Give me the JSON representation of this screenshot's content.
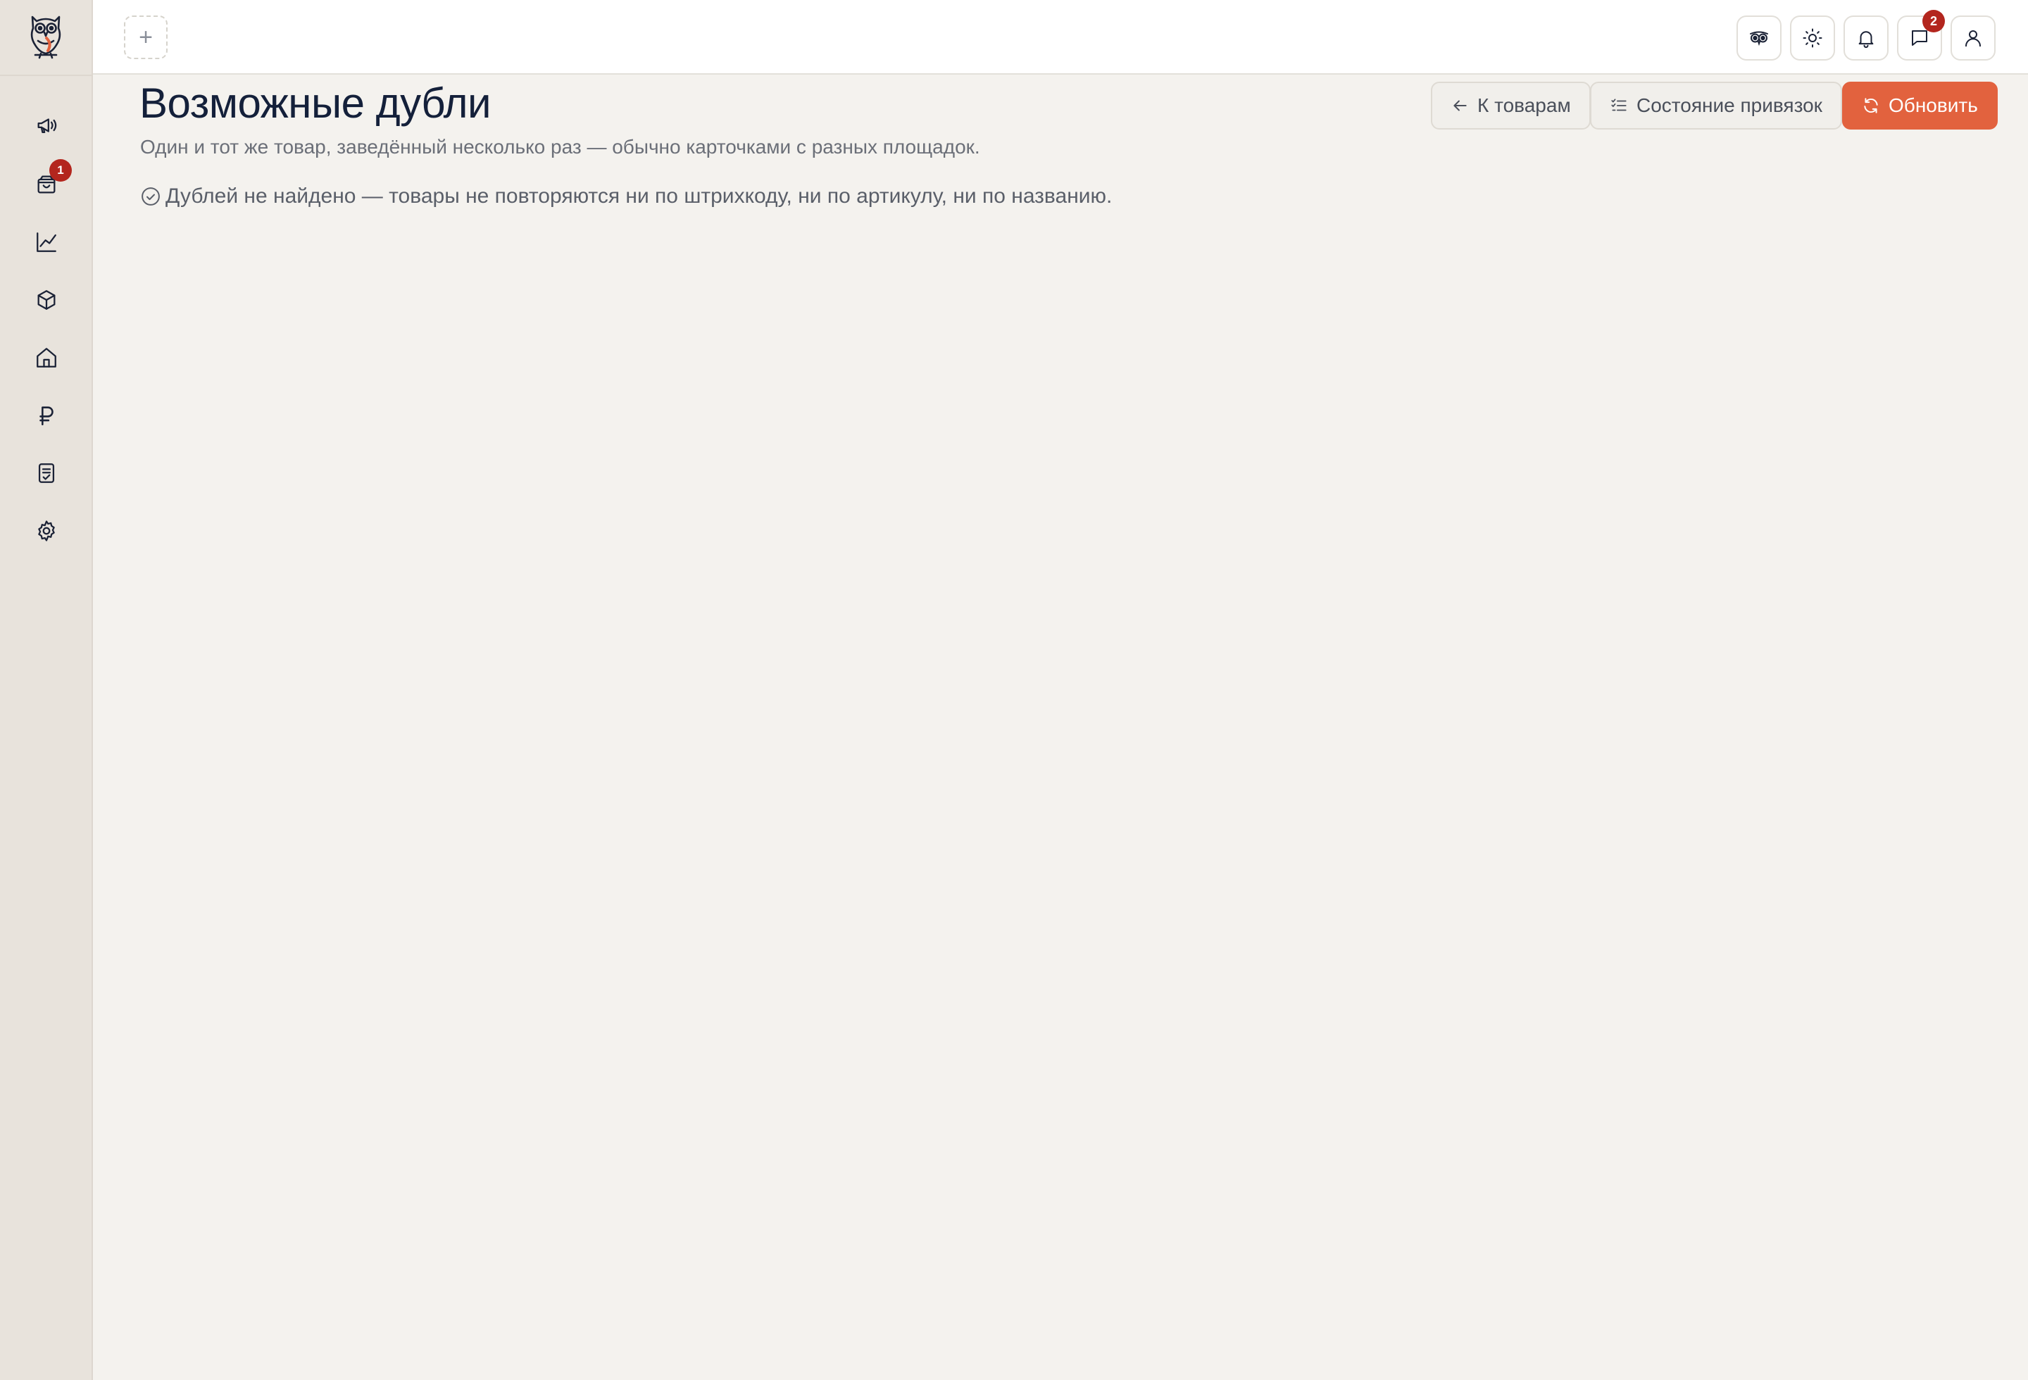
{
  "colors": {
    "accent": "#e2623e",
    "badge": "#b3261e",
    "sidebar_bg": "#e8e3dc",
    "page_bg": "#f4f2ee"
  },
  "sidebar": {
    "logo": "owl-logo",
    "items": [
      {
        "icon": "megaphone-icon",
        "badge": ""
      },
      {
        "icon": "shopping-bag-icon",
        "badge": "1"
      },
      {
        "icon": "line-chart-icon",
        "badge": ""
      },
      {
        "icon": "box-icon",
        "badge": ""
      },
      {
        "icon": "home-icon",
        "badge": ""
      },
      {
        "icon": "ruble-icon",
        "badge": ""
      },
      {
        "icon": "checklist-document-icon",
        "badge": ""
      },
      {
        "icon": "gear-icon",
        "badge": ""
      }
    ]
  },
  "topbar": {
    "add_tab_label": "+",
    "buttons": [
      {
        "icon": "owl-glasses-icon",
        "badge": ""
      },
      {
        "icon": "sun-icon",
        "badge": ""
      },
      {
        "icon": "bell-icon",
        "badge": ""
      },
      {
        "icon": "chat-icon",
        "badge": "2"
      },
      {
        "icon": "user-icon",
        "badge": ""
      }
    ]
  },
  "page": {
    "title": "Возможные дубли",
    "subtitle": "Один и тот же товар, заведённый несколько раз — обычно карточками с разных площадок.",
    "empty_message": "Дублей не найдено — товары не повторяются ни по штрихкоду, ни по артикулу, ни по названию."
  },
  "actions": {
    "back_label": "К товарам",
    "status_label": "Состояние привязок",
    "refresh_label": "Обновить"
  }
}
